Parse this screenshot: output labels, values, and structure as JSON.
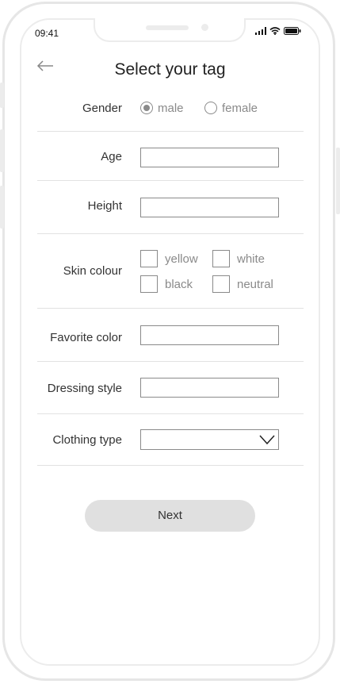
{
  "status_bar": {
    "time": "09:41",
    "icons": [
      "signal-icon",
      "wifi-icon",
      "battery-icon"
    ]
  },
  "header": {
    "back_icon": "arrow-left-icon",
    "title": "Select your tag"
  },
  "form": {
    "gender": {
      "label": "Gender",
      "options": [
        "male",
        "female"
      ],
      "selected": "male"
    },
    "age": {
      "label": "Age",
      "value": ""
    },
    "height": {
      "label": "Height",
      "value": ""
    },
    "skin_colour": {
      "label": "Skin colour",
      "options": [
        "yellow",
        "white",
        "black",
        "neutral"
      ],
      "checked": []
    },
    "favorite_color": {
      "label": "Favorite color",
      "value": ""
    },
    "dressing_style": {
      "label": "Dressing style",
      "value": ""
    },
    "clothing_type": {
      "label": "Clothing type",
      "value": "",
      "icon": "chevron-down-icon"
    }
  },
  "actions": {
    "next_label": "Next"
  },
  "colors": {
    "frame": "#e6e6e6",
    "border": "#8a8a8a",
    "button_bg": "#e0e0e0",
    "divider": "#e2e2e2"
  }
}
